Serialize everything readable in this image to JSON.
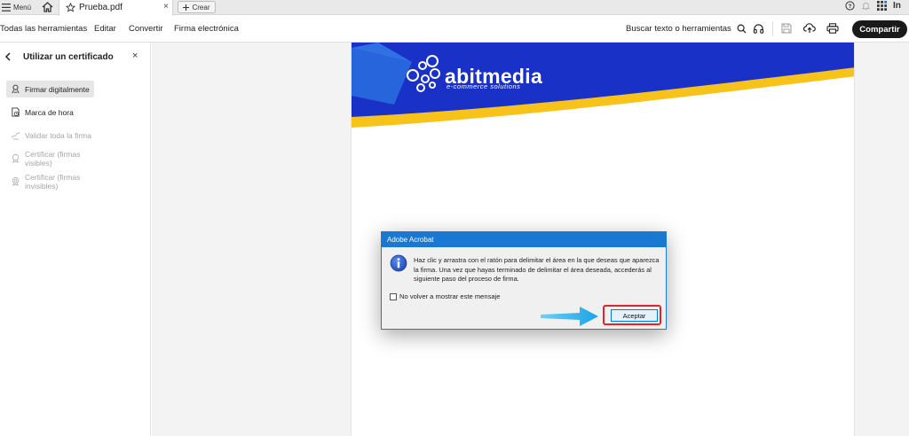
{
  "tabbar": {
    "menu_label": "Menú",
    "tab_title": "Prueba.pdf",
    "tab_close": "×",
    "create_label": "Crear",
    "user_initials": "In"
  },
  "toolbar": {
    "tabs": [
      "Todas las herramientas",
      "Editar",
      "Convertir",
      "Firma electrónica"
    ],
    "search_label": "Buscar texto o herramientas",
    "share_label": "Compartir"
  },
  "left_panel": {
    "title": "Utilizar un certificado",
    "close": "×",
    "items": [
      {
        "label": "Firmar digitalmente",
        "state": "selected"
      },
      {
        "label": "Marca de hora",
        "state": "enabled"
      },
      {
        "label": "Validar toda la firma",
        "state": "disabled"
      },
      {
        "label": "Certificar (firmas visibles)",
        "state": "disabled"
      },
      {
        "label": "Certificar (firmas invisibles)",
        "state": "disabled"
      }
    ]
  },
  "document": {
    "logo_name": "abitmedia",
    "logo_tagline": "e-commerce solutions",
    "colors": {
      "banner_blue": "#1a31c7",
      "accent_yellow": "#f7c21a"
    }
  },
  "dialog": {
    "title": "Adobe Acrobat",
    "message": "Haz clic y arrastra con el ratón para delimitar el área en la que deseas que aparezca la firma. Una vez que hayas terminado de delimitar el área deseada, accederás al siguiente paso del proceso de firma.",
    "checkbox_label": "No volver a mostrar este mensaje",
    "checkbox_checked": false,
    "accept_label": "Aceptar"
  },
  "icons": {
    "menu": "hamburger-icon",
    "home": "home-icon",
    "star": "star-icon",
    "help": "help-icon",
    "bell": "bell-icon",
    "apps": "apps-grid-icon",
    "search": "search-icon",
    "listen": "headphones-icon",
    "save": "save-icon",
    "upload": "upload-cloud-icon",
    "print": "print-icon",
    "info": "info-icon",
    "arrow": "arrow-right-icon"
  }
}
